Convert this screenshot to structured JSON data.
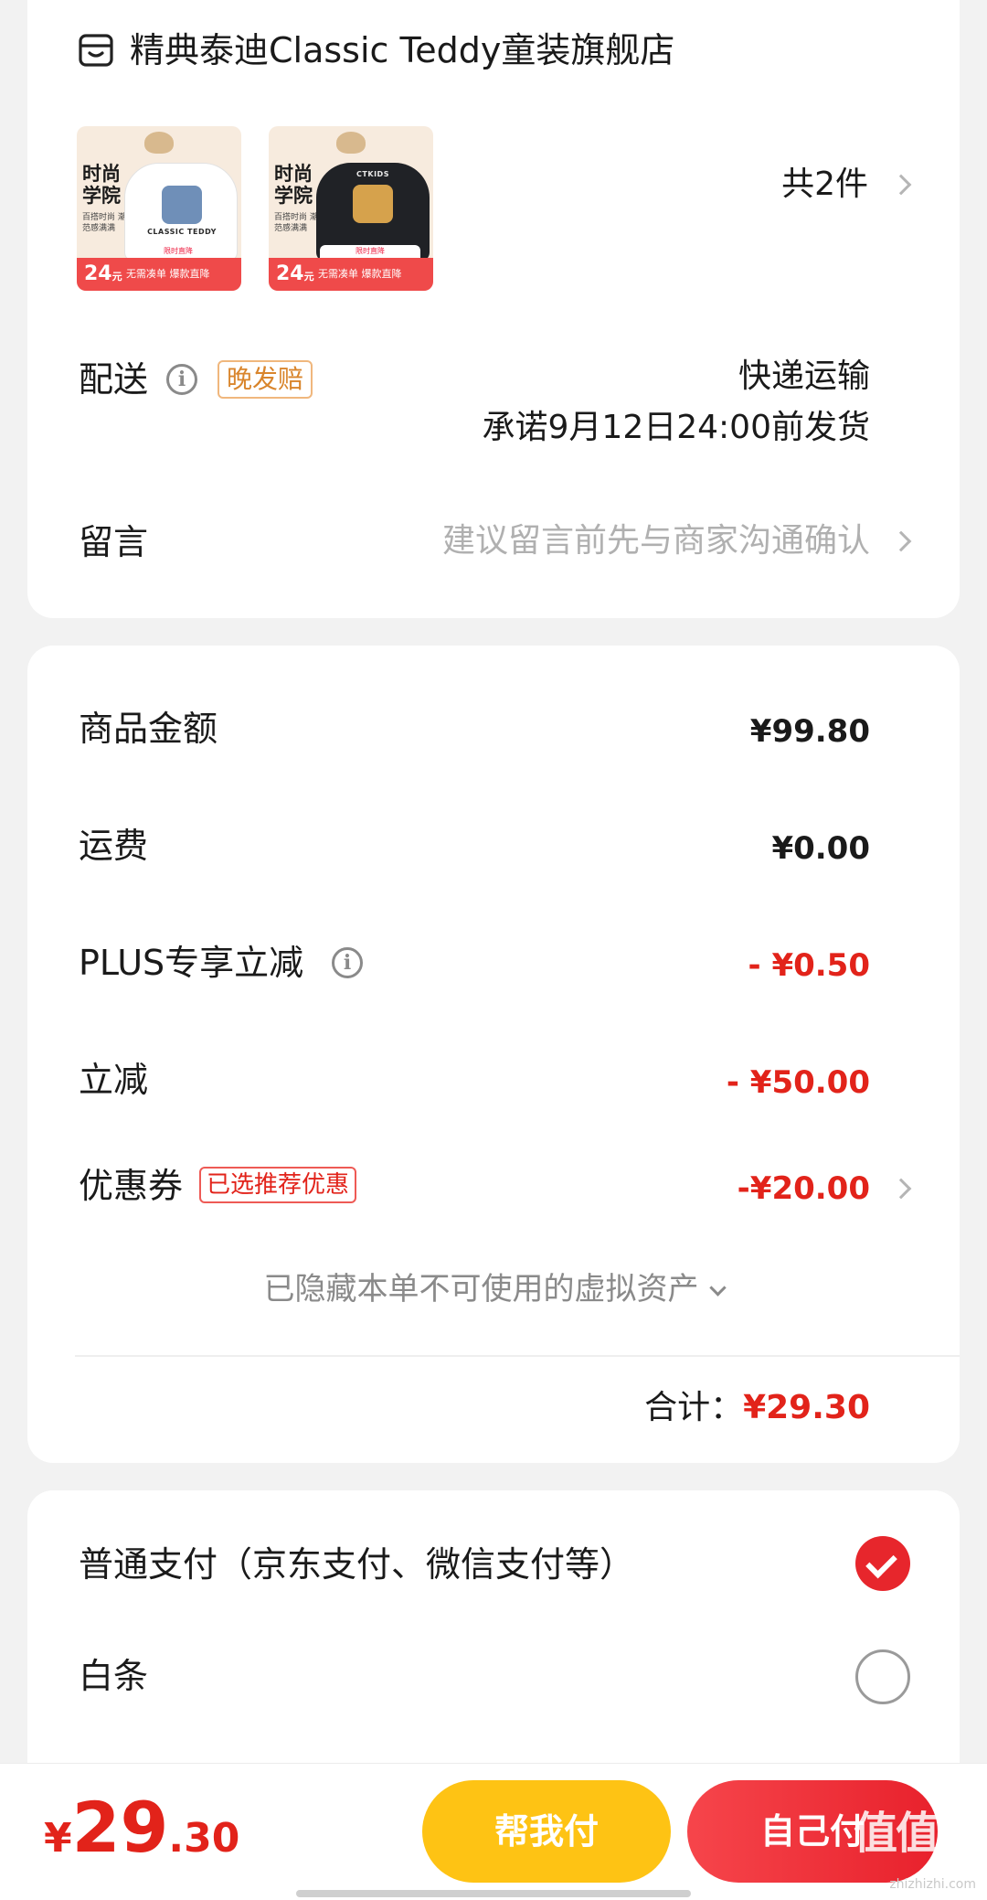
{
  "store": {
    "name": "精典泰迪Classic Teddy童装旗舰店",
    "item_count": "共2件",
    "products": [
      {
        "name": "white-sweatshirt",
        "promo_title": "时尚学院",
        "promo_sub": "百搭时尚 潮范感满满",
        "shirt_text": "CLASSIC TEDDY",
        "price_int": "24",
        "price_unit": "元",
        "band_text": "无需凑单 爆款直降",
        "band_top": "限时直降"
      },
      {
        "name": "black-sweatshirt",
        "promo_title": "时尚学院",
        "promo_sub": "百搭时尚 潮范感满满",
        "shirt_text": "CTKIDS",
        "price_int": "24",
        "price_unit": "元",
        "band_text": "无需凑单 爆款直降",
        "band_top": "限时直降"
      }
    ]
  },
  "delivery": {
    "label": "配送",
    "tag": "晚发赔",
    "method": "快递运输",
    "promise": "承诺9月12日24:00前发货"
  },
  "message": {
    "label": "留言",
    "placeholder": "建议留言前先与商家沟通确认"
  },
  "price_summary": {
    "rows": [
      {
        "label": "商品金额",
        "value": "¥99.80"
      },
      {
        "label": "运费",
        "value": "¥0.00"
      },
      {
        "label": "PLUS专享立减",
        "value": "- ¥0.50"
      },
      {
        "label": "立减",
        "value": "- ¥50.00"
      },
      {
        "label": "优惠券",
        "tag": "已选推荐优惠",
        "value": "-¥20.00"
      }
    ],
    "hidden_hint": "已隐藏本单不可使用的虚拟资产",
    "total_label": "合计：",
    "total_value": "¥29.30"
  },
  "payment": {
    "options": [
      {
        "label": "普通支付（京东支付、微信支付等）",
        "selected": true
      },
      {
        "label": "白条",
        "selected": false
      }
    ]
  },
  "bottom_bar": {
    "currency": "¥",
    "price_int": "29",
    "price_dec": ".30",
    "help_pay_label": "帮我付",
    "self_pay_label": "自己付",
    "watermark": "值值值",
    "watermark_sub": "zhizhizhi.com"
  },
  "colors": {
    "accent_red": "#e2231a",
    "tag_orange": "#d9852c",
    "help_button": "#fec314",
    "self_button": "#e8212c"
  },
  "icons": [
    "store-icon",
    "info-icon",
    "chevron-right-icon",
    "chevron-down-icon",
    "check-icon",
    "radio-empty-icon"
  ]
}
